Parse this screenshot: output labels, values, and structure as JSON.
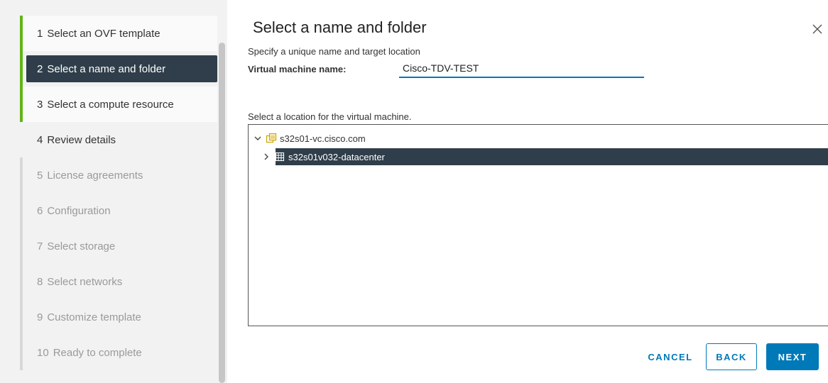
{
  "wizard": {
    "steps": [
      {
        "number": "1",
        "label": "Select an OVF template",
        "state": "done"
      },
      {
        "number": "2",
        "label": "Select a name and folder",
        "state": "active"
      },
      {
        "number": "3",
        "label": "Select a compute resource",
        "state": "done"
      },
      {
        "number": "4",
        "label": "Review details",
        "state": "pending"
      },
      {
        "number": "5",
        "label": "License agreements",
        "state": "disabled"
      },
      {
        "number": "6",
        "label": "Configuration",
        "state": "disabled"
      },
      {
        "number": "7",
        "label": "Select storage",
        "state": "disabled"
      },
      {
        "number": "8",
        "label": "Select networks",
        "state": "disabled"
      },
      {
        "number": "9",
        "label": "Customize template",
        "state": "disabled"
      },
      {
        "number": "10",
        "label": "Ready to complete",
        "state": "disabled"
      }
    ]
  },
  "main": {
    "title": "Select a name and folder",
    "subtitle": "Specify a unique name and target location",
    "vm_name_label": "Virtual machine name:",
    "vm_name_value": "Cisco-TDV-TEST",
    "location_label": "Select a location for the virtual machine."
  },
  "tree": {
    "root": {
      "label": "s32s01-vc.cisco.com",
      "icon": "vcenter-icon",
      "expanded": true
    },
    "child": {
      "label": "s32s01v032-datacenter",
      "icon": "datacenter-icon",
      "expanded": false,
      "selected": true
    }
  },
  "footer": {
    "cancel_label": "CANCEL",
    "back_label": "BACK",
    "next_label": "NEXT"
  },
  "colors": {
    "accent": "#0079b8",
    "selected_bg": "#2f3e4a",
    "completed_bar": "#60b515",
    "sidebar_bg": "#f2f2f2"
  }
}
